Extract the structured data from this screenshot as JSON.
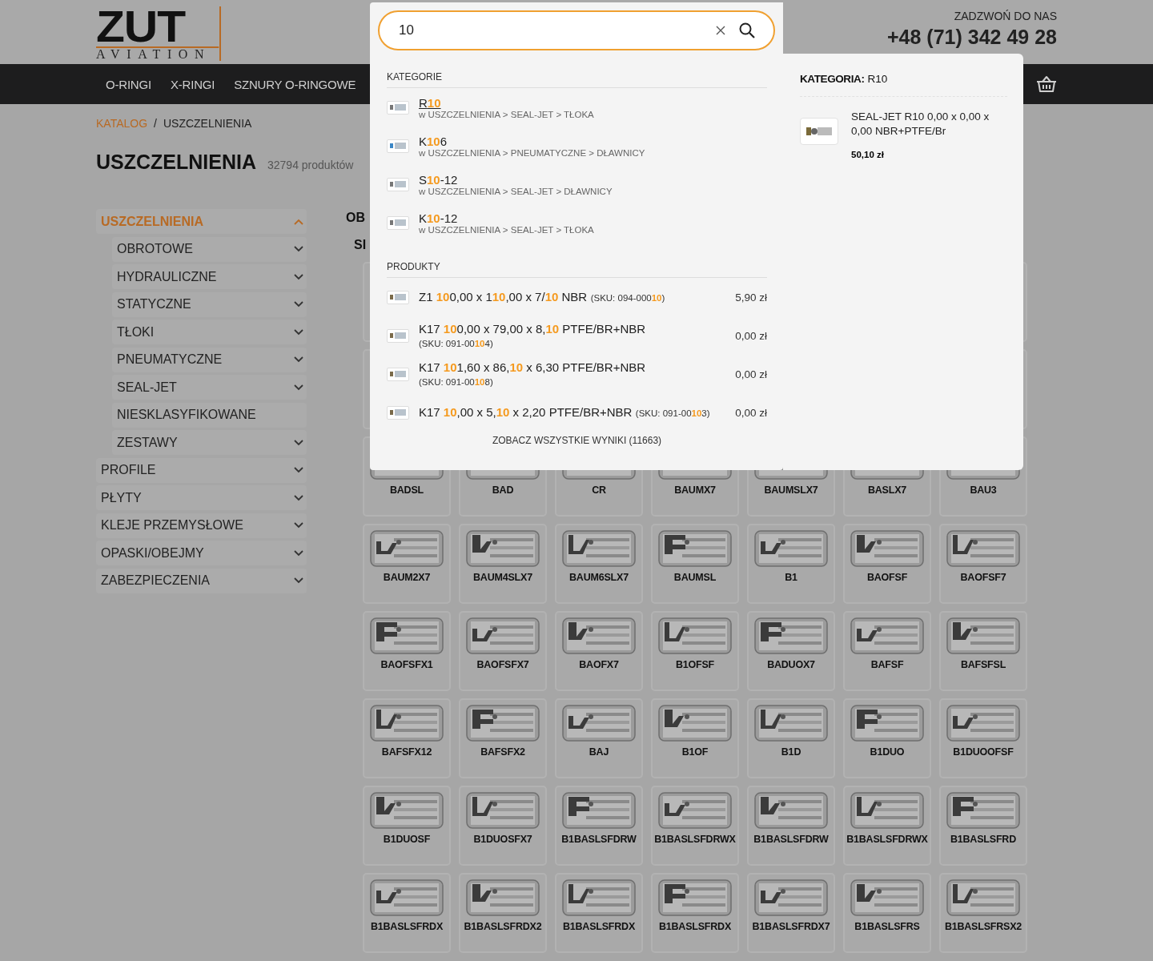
{
  "header": {
    "logo_main": "ZUT",
    "logo_sub": "AVIATION",
    "call_label": "ZADZWOŃ DO NAS",
    "phone": "+48 (71) 342 49 28"
  },
  "nav": [
    "O-RINGI",
    "X-RINGI",
    "SZNURY O-RINGOWE"
  ],
  "breadcrumb": [
    "KATALOG",
    "USZCZELNIENIA"
  ],
  "breadcrumb_separator": "/",
  "page": {
    "title": "USZCZELNIENIA",
    "count": "32794 produktów"
  },
  "sidebar": [
    {
      "label": "USZCZELNIENIA",
      "selected": true,
      "expanded": true,
      "children": [
        {
          "label": "OBROTOWE",
          "selected": false,
          "expanded": false,
          "has_children": true
        },
        {
          "label": "HYDRAULICZNE",
          "selected": false,
          "expanded": false,
          "has_children": true
        },
        {
          "label": "STATYCZNE",
          "selected": false,
          "expanded": false,
          "has_children": true
        },
        {
          "label": "TŁOKI",
          "selected": false,
          "expanded": false,
          "has_children": true
        },
        {
          "label": "PNEUMATYCZNE",
          "selected": false,
          "expanded": false,
          "has_children": true
        },
        {
          "label": "SEAL-JET",
          "selected": false,
          "expanded": false,
          "has_children": true
        },
        {
          "label": "NIESKLASYFIKOWANE",
          "selected": false,
          "has_children": false
        },
        {
          "label": "ZESTAWY",
          "selected": false,
          "expanded": false,
          "has_children": true
        }
      ]
    },
    {
      "label": "PROFILE",
      "selected": false,
      "expanded": false,
      "has_children": true
    },
    {
      "label": "PŁYTY",
      "selected": false,
      "expanded": false,
      "has_children": true
    },
    {
      "label": "KLEJE PRZEMYSŁOWE",
      "selected": false,
      "expanded": false,
      "has_children": true
    },
    {
      "label": "OPASKI/OBEJMY",
      "selected": false,
      "expanded": false,
      "has_children": true
    },
    {
      "label": "ZABEZPIECZENIA",
      "selected": false,
      "expanded": false,
      "has_children": true
    }
  ],
  "content_headings": [
    "OB",
    "SI"
  ],
  "grid": [
    "BADSL",
    "BAD",
    "CR",
    "BAUMX7",
    "BAUMSLX7",
    "BASLX7",
    "BAU3",
    "BAUM2X7",
    "BAUM4SLX7",
    "BAUM6SLX7",
    "BAUMSL",
    "B1",
    "BAOFSF",
    "BAOFSF7",
    "BAOFSFX1",
    "BAOFSFX7",
    "BAOFX7",
    "B1OFSF",
    "BADUOX7",
    "BAFSF",
    "BAFSFSL",
    "BAFSFX12",
    "BAFSFX2",
    "BAJ",
    "B1OF",
    "B1D",
    "B1DUO",
    "B1DUOOFSF",
    "B1DUOSF",
    "B1DUOSFX7",
    "B1BASLSFDRW",
    "B1BASLSFDRWX",
    "B1BASLSFDRW",
    "B1BASLSFDRWX",
    "B1BASLSFRD",
    "B1BASLSFRDX",
    "B1BASLSFRDX2",
    "B1BASLSFRDX",
    "B1BASLSFRDX",
    "B1BASLSFRDX7",
    "B1BASLSFRS",
    "B1BASLSFRSX2"
  ],
  "search": {
    "value": "10",
    "categories_title": "KATEGORIE",
    "categories": [
      {
        "name": "R**10**",
        "path": "w USZCZELNIENIA > SEAL-JET > TŁOKA",
        "selected": true
      },
      {
        "name": "K**10**6",
        "path": "w USZCZELNIENIA > PNEUMATYCZNE > DŁAWNICY",
        "selected": false
      },
      {
        "name": "S**10**-12",
        "path": "w USZCZELNIENIA > SEAL-JET > DŁAWNICY",
        "selected": false
      },
      {
        "name": "K**10**-12",
        "path": "w USZCZELNIENIA > SEAL-JET > TŁOKA",
        "selected": false
      }
    ],
    "products_title": "PRODUKTY",
    "products": [
      {
        "name": "Z1 **10**0,00 x 1**10**,00 x 7/**10** NBR",
        "sku": "(SKU: 094-000**10**)",
        "price": "5,90 zł",
        "sku_inline": true
      },
      {
        "name": "K17 **10**0,00 x 79,00 x 8,**10** PTFE/BR+NBR",
        "sku": "(SKU: 091-00**10**4)",
        "price": "0,00 zł",
        "sku_inline": false
      },
      {
        "name": "K17 **10**1,60 x 86,**10** x 6,30 PTFE/BR+NBR",
        "sku": "(SKU: 091-00**10**8)",
        "price": "0,00 zł",
        "sku_inline": false
      },
      {
        "name": "K17 **10**,00 x 5,**10** x 2,20 PTFE/BR+NBR",
        "sku": "(SKU: 091-00**10**3)",
        "price": "0,00 zł",
        "sku_inline": true
      }
    ],
    "see_all": "ZOBACZ WSZYSTKIE WYNIKI (11663)",
    "preview": {
      "label": "KATEGORIA:",
      "category": "R10",
      "product": "SEAL-JET R10 0,00 x 0,00 x 0,00 NBR+PTFE/Br",
      "price": "50,10 zł"
    }
  }
}
